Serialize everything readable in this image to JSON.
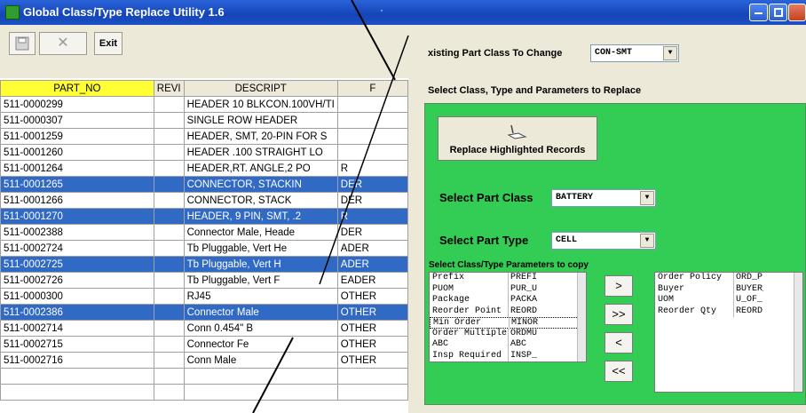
{
  "window": {
    "title": "Global Class/Type Replace Utility   1.6",
    "dot": "·"
  },
  "toolbar": {
    "save_icon": "floppy-disk-icon",
    "delete_icon": "x-icon",
    "exit_label": "Exit"
  },
  "grid": {
    "columns": [
      "PART_NO",
      "REVI",
      "DESCRIPT",
      "F"
    ],
    "rows": [
      {
        "part": "511-0000299",
        "rev": "",
        "desc": "HEADER 10 BLKCON.100VH/TI",
        "f": "",
        "selected": false
      },
      {
        "part": "511-0000307",
        "rev": "",
        "desc": "SINGLE ROW HEADER",
        "f": "",
        "selected": false
      },
      {
        "part": "511-0001259",
        "rev": "",
        "desc": "HEADER, SMT, 20-PIN FOR S",
        "f": "",
        "selected": false
      },
      {
        "part": "511-0001260",
        "rev": "",
        "desc": "HEADER .100 STRAIGHT LO",
        "f": "",
        "selected": false
      },
      {
        "part": "511-0001264",
        "rev": "",
        "desc": "HEADER,RT. ANGLE,2 PO",
        "f": "R",
        "selected": false
      },
      {
        "part": "511-0001265",
        "rev": "",
        "desc": "CONNECTOR, STACKIN",
        "f": "DER",
        "selected": true
      },
      {
        "part": "511-0001266",
        "rev": "",
        "desc": "CONNECTOR, STACK",
        "f": "DER",
        "selected": false
      },
      {
        "part": "511-0001270",
        "rev": "",
        "desc": "HEADER, 9 PIN, SMT, .2",
        "f": "R",
        "selected": true
      },
      {
        "part": "511-0002388",
        "rev": "",
        "desc": "Connector Male, Heade",
        "f": "DER",
        "selected": false
      },
      {
        "part": "511-0002724",
        "rev": "",
        "desc": "Tb Pluggable, Vert He",
        "f": "ADER",
        "selected": false
      },
      {
        "part": "511-0002725",
        "rev": "",
        "desc": "Tb Pluggable, Vert H",
        "f": "ADER",
        "selected": true
      },
      {
        "part": "511-0002726",
        "rev": "",
        "desc": "Tb Pluggable, Vert F",
        "f": "EADER",
        "selected": false
      },
      {
        "part": "511-0000300",
        "rev": "",
        "desc": "RJ45",
        "f": "OTHER",
        "selected": false
      },
      {
        "part": "511-0002386",
        "rev": "",
        "desc": "Connector Male",
        "f": "OTHER",
        "selected": true
      },
      {
        "part": "511-0002714",
        "rev": "",
        "desc": "Conn 0.454\" B",
        "f": "OTHER",
        "selected": false
      },
      {
        "part": "511-0002715",
        "rev": "",
        "desc": "Connector Fe",
        "f": "OTHER",
        "selected": false
      },
      {
        "part": "511-0002716",
        "rev": "",
        "desc": "Conn Male",
        "f": "OTHER",
        "selected": false
      },
      {
        "part": "",
        "rev": "",
        "desc": "",
        "f": "",
        "selected": false
      },
      {
        "part": "",
        "rev": "",
        "desc": "",
        "f": "",
        "selected": false
      }
    ]
  },
  "right": {
    "existing_label": "xisting Part Class To Change",
    "existing_value": "CON-SMT",
    "select_header": "Select Class, Type and Parameters to Replace",
    "replace_button": "Replace Highlighted Records",
    "replace_icon": "hand-pointer-icon",
    "class_label": "Select Part Class",
    "class_value": "BATTERY",
    "type_label": "Select Part Type",
    "type_value": "CELL",
    "params_label": "Select Class/Type Parameters to copy",
    "available": [
      {
        "name": "Prefix",
        "field": "PREFI:"
      },
      {
        "name": "PUOM",
        "field": "PUR_U("
      },
      {
        "name": "Package",
        "field": "PACKA("
      },
      {
        "name": "Reorder Point",
        "field": "REORD("
      },
      {
        "name": "Min Order",
        "field": "MINORI"
      },
      {
        "name": "Order Multiple",
        "field": "ORDMU("
      },
      {
        "name": "ABC",
        "field": "ABC"
      },
      {
        "name": "Insp Required",
        "field": "INSP_("
      }
    ],
    "selected_params": [
      {
        "name": "Order Policy",
        "field": "ORD_P("
      },
      {
        "name": "Buyer",
        "field": "BUYER_"
      },
      {
        "name": "UOM",
        "field": "U_OF_I"
      },
      {
        "name": "Reorder Qty",
        "field": "REORD("
      }
    ],
    "btn_add": ">",
    "btn_add_all": ">>",
    "btn_remove": "<",
    "btn_remove_all": "<<"
  }
}
